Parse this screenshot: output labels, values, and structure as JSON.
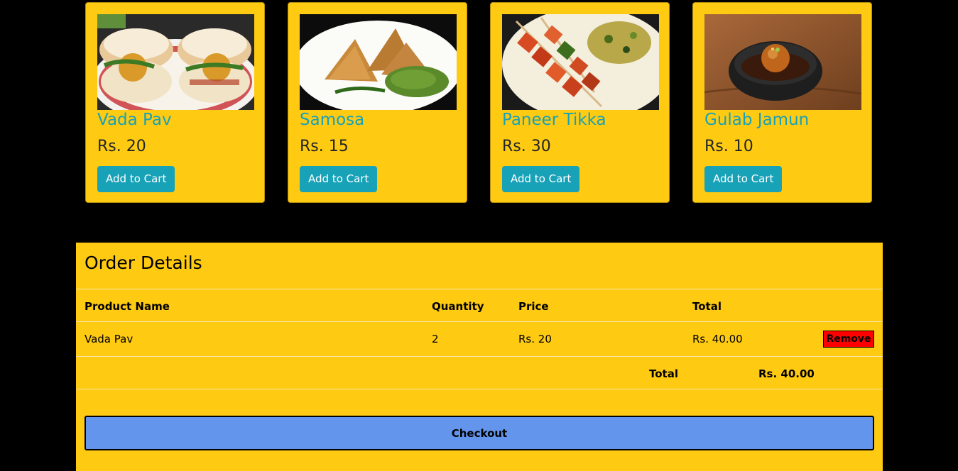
{
  "products": [
    {
      "name": "Vada Pav",
      "price": "Rs. 20",
      "button": "Add to Cart",
      "image_icon": "vada-pav-photo"
    },
    {
      "name": "Samosa",
      "price": "Rs. 15",
      "button": "Add to Cart",
      "image_icon": "samosa-photo"
    },
    {
      "name": "Paneer Tikka",
      "price": "Rs. 30",
      "button": "Add to Cart",
      "image_icon": "paneer-tikka-photo"
    },
    {
      "name": "Gulab Jamun",
      "price": "Rs. 10",
      "button": "Add to Cart",
      "image_icon": "gulab-jamun-photo"
    }
  ],
  "order": {
    "title": "Order Details",
    "columns": [
      "Product Name",
      "Quantity",
      "Price",
      "Total"
    ],
    "rows": [
      {
        "product": "Vada Pav",
        "quantity": "2",
        "price": "Rs. 20",
        "total": "Rs. 40.00",
        "remove_label": "Remove"
      }
    ],
    "total_label": "Total",
    "total_value": "Rs. 40.00",
    "checkout_label": "Checkout"
  },
  "colors": {
    "page_background": "#000000",
    "card_background": "#ffca12",
    "accent": "#17a2b8",
    "remove": "#ff0000",
    "checkout": "#6495ed"
  }
}
